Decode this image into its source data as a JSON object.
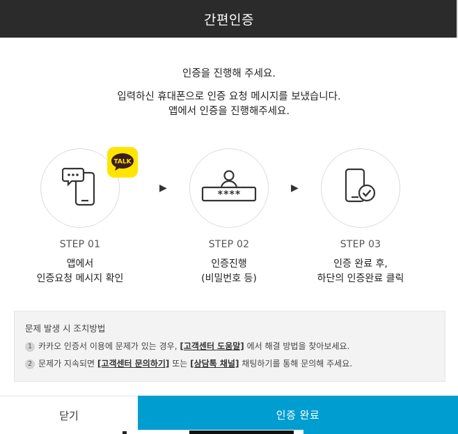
{
  "header": {
    "title": "간편인증"
  },
  "intro": {
    "line1": "인증을 진행해 주세요.",
    "line2": "입력하신 휴대폰으로 인증 요청 메시지를 보냈습니다.",
    "line3": "앱에서 인증을 진행해주세요."
  },
  "badge": {
    "label": "TALK",
    "color": "#fee500"
  },
  "steps": [
    {
      "num": "STEP 01",
      "desc1": "앱에서",
      "desc2": "인증요청 메시지 확인",
      "icon": "phone-message-icon"
    },
    {
      "num": "STEP 02",
      "desc1": "인증진행",
      "desc2": "(비밀번호 등)",
      "icon": "password-user-icon"
    },
    {
      "num": "STEP 03",
      "desc1": "인증 완료 후,",
      "desc2": "하단의 인증완료 클릭",
      "icon": "phone-check-icon"
    }
  ],
  "notice": {
    "title": "문제 발생 시 조치방법",
    "items": [
      {
        "num": "1",
        "pre": "카카오 인증서 이용에 문제가 있는 경우, ",
        "link": "[고객센터 도움말]",
        "post": " 에서 해결 방법을 찾아보세요."
      },
      {
        "num": "2",
        "pre": "문제가 지속되면 ",
        "link1": "[고객센터 문의하기]",
        "mid": " 또는 ",
        "link2": "[상담톡 채널]",
        "post": " 채팅하기를 통해 문의해 주세요."
      }
    ]
  },
  "footer": {
    "close_label": "닫기",
    "done_label": "인증 완료",
    "accent": "#009ed0"
  },
  "colors": {
    "header_bg": "#2b2b2b",
    "notice_bg": "#f3f3f3"
  }
}
